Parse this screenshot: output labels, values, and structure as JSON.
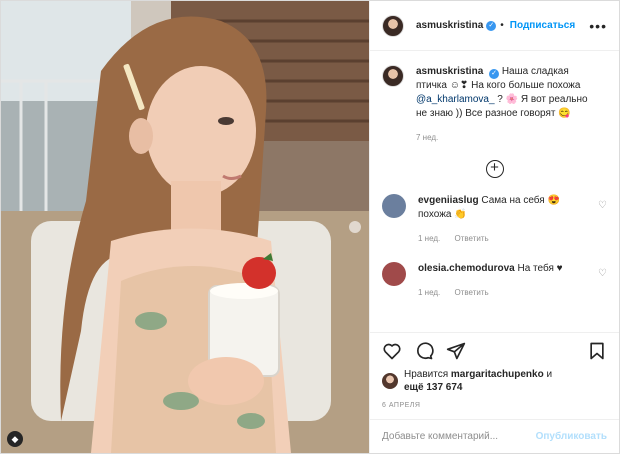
{
  "header": {
    "username": "asmuskristina",
    "follow_label": "Подписаться",
    "separator": "•",
    "more": "•••"
  },
  "caption": {
    "username": "asmuskristina",
    "text_part1": "Наша сладкая птичка ☺❣ На кого больше похожа ",
    "mention": "@a_kharlamova_",
    "text_part2": " ? 🌸 Я вот реально не знаю )) Все разное говорят 😋",
    "time": "7 нед."
  },
  "load_more": "+",
  "comments": [
    {
      "username": "evgeniiaslug",
      "text": "Сама на себя 😍 похожа 👏",
      "time": "1 нед.",
      "reply": "Ответить",
      "avatar_color": "#6b7f9e"
    },
    {
      "username": "olesia.chemodurova",
      "text": "На тебя ♥",
      "time": "1 нед.",
      "reply": "Ответить",
      "avatar_color": "#a04a4a"
    }
  ],
  "likes": {
    "prefix": "Нравится ",
    "user": "margaritachupenko",
    "and": " и",
    "others": "ещё 137 674"
  },
  "date": "6 АПРЕЛЯ",
  "add_comment": {
    "placeholder": "Добавьте комментарий...",
    "publish_label": "Опубликовать"
  },
  "colors": {
    "accent": "#0095f6",
    "verified": "#3897f0",
    "muted": "#8e8e8e"
  },
  "icons": {
    "like": "heart-icon",
    "comment": "comment-icon",
    "share": "share-icon",
    "save": "bookmark-icon",
    "photo_badge": "brand-icon"
  }
}
